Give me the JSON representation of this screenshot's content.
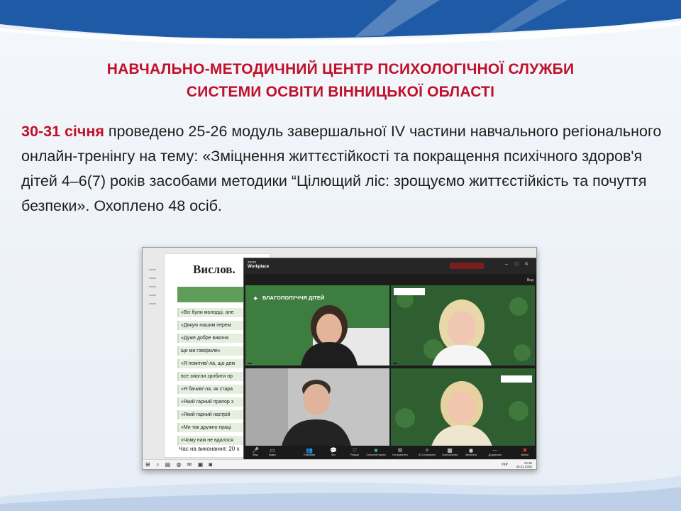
{
  "title": {
    "line1": "НАВЧАЛЬНО-МЕТОДИЧНИЙ ЦЕНТР  ПСИХОЛОГІЧНОЇ СЛУЖБИ",
    "line2": "СИСТЕМИ ОСВІТИ ВІННИЦЬКОЇ ОБЛАСТІ"
  },
  "body": {
    "date": "30-31 січня",
    "text": " проведено 25-26 модуль завершальної IV частини  навчального регіонального онлайн-тренінгу на тему: «Зміцнення життєстійкості та покращення психічного здоров'я дітей 4–6(7) років засобами методики “Цілющий ліс: зрощуємо життєстійкість та почуття безпеки». Охоплено 48 осіб."
  },
  "colors": {
    "accent": "#c0102a",
    "deco_blue": "#1f5aa6",
    "zoom_dark": "#1c1c1c",
    "table_green": "#5f9e59"
  },
  "screenshot": {
    "document": {
      "heading": "Вислов.",
      "rows": [
        "«Всі були молодці, але",
        "«Дякую нашим перем",
        "«Дуже добре викона",
        "що ми говорили»",
        "«Я помітив/-ла, що дем",
        "все змогли зробити пр",
        "«Я бачив/-ла, як стара",
        "«Який гарний прапор з",
        "«Який гарний настрій",
        "«Ми так дружно праці",
        "«Чому нам не вдалося"
      ],
      "footer": "Час на виконання: 20 х"
    },
    "zoom": {
      "brand_small": "zoom",
      "brand": "Workplace",
      "top_pill": "",
      "view_label": "Вид",
      "tiles": [
        {
          "name": "",
          "overlay_title": "БЛАГОПОЛУЧЧЯ ДІТЕЙ",
          "overlay_sub": ""
        },
        {
          "name": ""
        },
        {
          "name": ""
        },
        {
          "name": ""
        }
      ],
      "toolbar": [
        {
          "label": "Звук",
          "icon": "mic-icon"
        },
        {
          "label": "Відео",
          "icon": "video-icon"
        },
        {
          "label": "Учасники",
          "icon": "participants-icon"
        },
        {
          "label": "Чат",
          "icon": "chat-icon"
        },
        {
          "label": "Реакції",
          "icon": "reactions-icon"
        },
        {
          "label": "Спільний екран",
          "icon": "share-icon"
        },
        {
          "label": "Інструменти",
          "icon": "apps-icon"
        },
        {
          "label": "AI Companion",
          "icon": "ai-icon"
        },
        {
          "label": "Приложения",
          "icon": "grid-icon"
        },
        {
          "label": "Записати",
          "icon": "record-icon"
        },
        {
          "label": "Додатково",
          "icon": "more-icon"
        },
        {
          "label": "Вийти",
          "icon": "end-icon"
        }
      ]
    },
    "taskbar": {
      "lang": "УКР",
      "time": "13:35",
      "date": "30.01.2025"
    }
  }
}
